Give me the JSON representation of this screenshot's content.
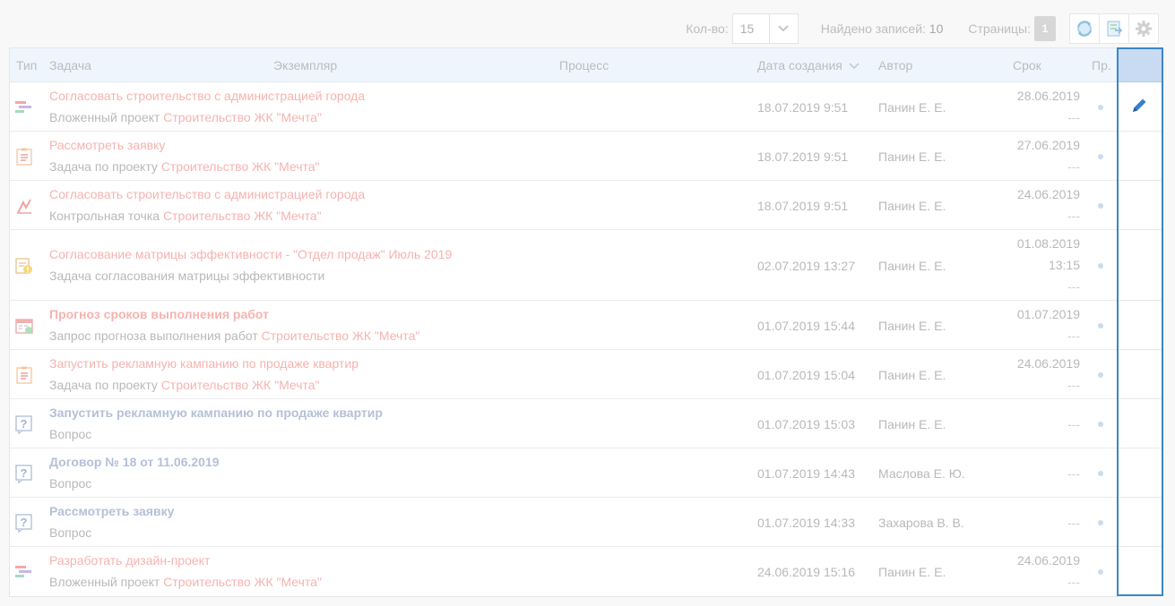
{
  "toolbar": {
    "qty_label": "Кол-во:",
    "qty_value": "15",
    "found_label": "Найдено записей:",
    "found_value": "10",
    "pages_label": "Страницы:",
    "page_current": "1",
    "icons": [
      "refresh-icon",
      "export-icon",
      "settings-gear-icon"
    ]
  },
  "columns": {
    "type": "Тип",
    "task": "Задача",
    "instance": "Экземпляр",
    "process": "Процесс",
    "created": "Дата создания",
    "author": "Автор",
    "due": "Срок",
    "priority": "Пр."
  },
  "rows": [
    {
      "icon": "gantt-icon",
      "title": "Согласовать строительство с администрацией города",
      "subtitle": "Вложенный проект",
      "link": "Строительство ЖК \"Мечта\"",
      "created": "18.07.2019 9:51",
      "author": "Панин Е. Е.",
      "due1": "28.06.2019",
      "due2": "",
      "due3": "---"
    },
    {
      "icon": "task-clipboard-icon",
      "title": "Рассмотреть заявку",
      "subtitle": "Задача по проекту",
      "link": "Строительство ЖК \"Мечта\"",
      "created": "18.07.2019 9:51",
      "author": "Панин Е. Е.",
      "due1": "27.06.2019",
      "due2": "",
      "due3": "---"
    },
    {
      "icon": "checkpoint-icon",
      "title": "Согласовать строительство с администрацией города",
      "subtitle": "Контрольная точка",
      "link": "Строительство ЖК \"Мечта\"",
      "created": "18.07.2019 9:51",
      "author": "Панин Е. Е.",
      "due1": "24.06.2019",
      "due2": "",
      "due3": "---"
    },
    {
      "icon": "matrix-approval-icon",
      "title": "Согласование матрицы эффективности - \"Отдел продаж\" Июль 2019",
      "subtitle": "Задача согласования матрицы эффективности",
      "link": "",
      "created": "02.07.2019 13:27",
      "author": "Панин Е. Е.",
      "due1": "01.08.2019",
      "due2": "13:15",
      "due3": "---"
    },
    {
      "icon": "forecast-calendar-icon",
      "title": "Прогноз сроков выполнения работ",
      "subtitle": "Запрос прогноза выполнения работ",
      "link": "Строительство ЖК \"Мечта\"",
      "created": "01.07.2019 15:44",
      "author": "Панин Е. Е.",
      "due1": "01.07.2019",
      "due2": "",
      "due3": "---"
    },
    {
      "icon": "task-clipboard-icon",
      "title": "Запустить рекламную кампанию по продаже квартир",
      "subtitle": "Задача по проекту",
      "link": "Строительство ЖК \"Мечта\"",
      "created": "01.07.2019 15:04",
      "author": "Панин Е. Е.",
      "due1": "24.06.2019",
      "due2": "",
      "due3": "---"
    },
    {
      "icon": "question-icon",
      "title": "Запустить рекламную кампанию по продаже квартир",
      "subtitle": "Вопрос",
      "link": "",
      "created": "01.07.2019 15:03",
      "author": "Панин Е. Е.",
      "due1": "---",
      "due2": "",
      "due3": ""
    },
    {
      "icon": "question-icon",
      "title": "Договор № 18 от 11.06.2019",
      "subtitle": "Вопрос",
      "link": "",
      "created": "01.07.2019 14:43",
      "author": "Маслова Е. Ю.",
      "due1": "---",
      "due2": "",
      "due3": ""
    },
    {
      "icon": "question-icon",
      "title": "Рассмотреть заявку",
      "subtitle": "Вопрос",
      "link": "",
      "created": "01.07.2019 14:33",
      "author": "Захарова В. В.",
      "due1": "---",
      "due2": "",
      "due3": ""
    },
    {
      "icon": "gantt-icon",
      "title": "Разработать дизайн-проект",
      "subtitle": "Вложенный проект",
      "link": "Строительство ЖК \"Мечта\"",
      "created": "24.06.2019 15:16",
      "author": "Панин Е. Е.",
      "due1": "24.06.2019",
      "due2": "",
      "due3": "---"
    }
  ],
  "actions": {
    "edit_icon": "pencil-icon"
  }
}
